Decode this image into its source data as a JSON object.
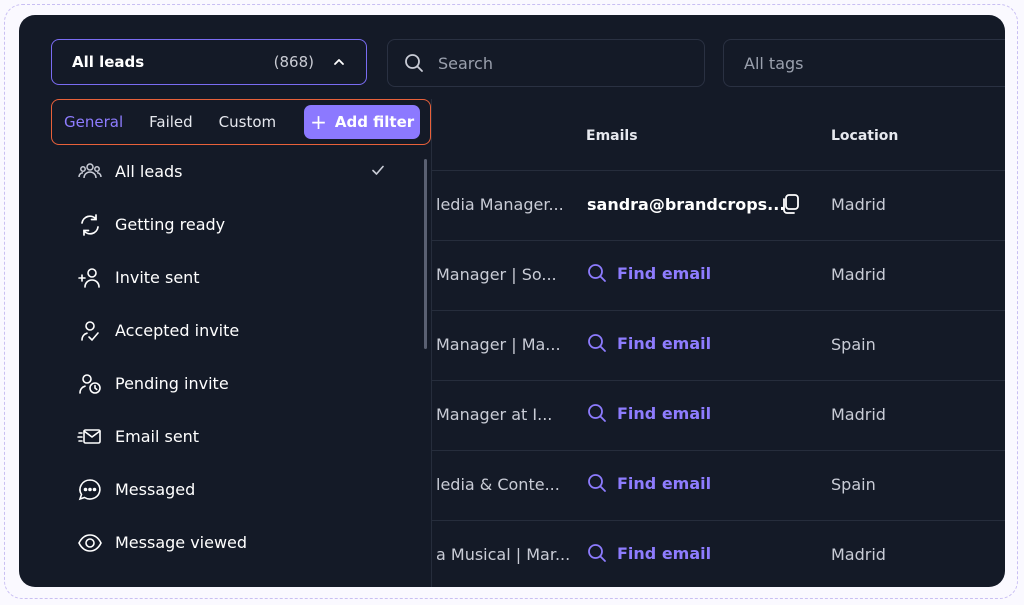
{
  "lead_filter": {
    "label": "All leads",
    "count": "(868)"
  },
  "search": {
    "placeholder": "Search"
  },
  "tags": {
    "label": "All tags"
  },
  "filter_tabs": {
    "general": "General",
    "failed": "Failed",
    "custom": "Custom",
    "add_filter": "Add filter"
  },
  "menu": [
    {
      "label": "All leads",
      "icon": "people-icon",
      "selected": true
    },
    {
      "label": "Getting ready",
      "icon": "refresh-icon"
    },
    {
      "label": "Invite sent",
      "icon": "add-user-icon"
    },
    {
      "label": "Accepted invite",
      "icon": "accepted-invite-icon"
    },
    {
      "label": "Pending invite",
      "icon": "pending-invite-icon"
    },
    {
      "label": "Email sent",
      "icon": "email-sent-icon"
    },
    {
      "label": "Messaged",
      "icon": "chat-bubble-icon"
    },
    {
      "label": "Message viewed",
      "icon": "eye-icon"
    }
  ],
  "table": {
    "headers": {
      "emails": "Emails",
      "location": "Location"
    },
    "rows": [
      {
        "title": "ledia Manager...",
        "email": "sandra@brandcrops...",
        "location": "Madrid"
      },
      {
        "title": "Manager | So...",
        "find": "Find email",
        "location": "Madrid"
      },
      {
        "title": "Manager | Ma...",
        "find": "Find email",
        "location": "Spain"
      },
      {
        "title": "Manager at I...",
        "find": "Find email",
        "location": "Madrid"
      },
      {
        "title": "ledia & Conte...",
        "find": "Find email",
        "location": "Spain"
      },
      {
        "title": "a Musical | Mar...",
        "find": "Find email",
        "location": "Madrid"
      }
    ]
  },
  "colors": {
    "accent": "#8c79ff",
    "highlight_border": "#e8613a",
    "background": "#141a27"
  }
}
